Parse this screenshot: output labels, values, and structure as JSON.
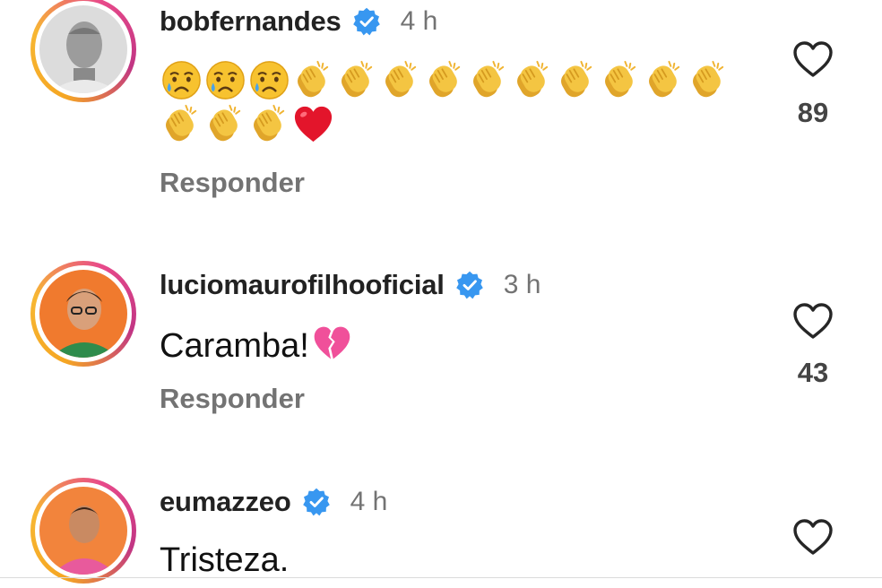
{
  "colors": {
    "verified": "#3897f0",
    "secondary_text": "#737373",
    "heart_outline": "#262626",
    "story_ring": [
      "#f5a623",
      "#e84a8a",
      "#c13584"
    ]
  },
  "comments": [
    {
      "username": "bobfernandes",
      "verified": true,
      "time": "4 h",
      "emoji_line1": [
        "crying-face",
        "crying-face",
        "crying-face",
        "clapping-hands",
        "clapping-hands",
        "clapping-hands",
        "clapping-hands",
        "clapping-hands",
        "clapping-hands",
        "clapping-hands",
        "clapping-hands",
        "clapping-hands",
        "clapping-hands"
      ],
      "emoji_line2": [
        "clapping-hands",
        "clapping-hands",
        "clapping-hands",
        "red-heart"
      ],
      "reply_label": "Responder",
      "likes": "89"
    },
    {
      "username": "luciomaurofilhooficial",
      "verified": true,
      "time": "3 h",
      "text": "Caramba!",
      "text_emoji": "broken-heart",
      "reply_label": "Responder",
      "likes": "43"
    },
    {
      "username": "eumazzeo",
      "verified": true,
      "time": "4 h",
      "text": "Tristeza.",
      "likes": ""
    }
  ]
}
